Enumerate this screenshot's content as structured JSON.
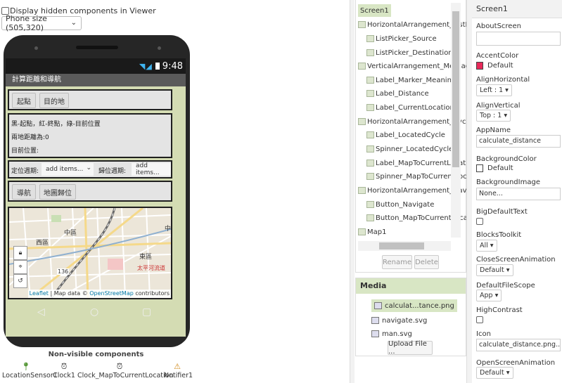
{
  "viewer": {
    "hidden_label": "Display hidden components in Viewer",
    "phone_size": "Phone size (505,320)",
    "time": "9:48",
    "screen_title": "計算距離和導航",
    "buttons_row1": [
      "起點",
      "目的地"
    ],
    "labels": [
      "黑-起點，紅-終點，綠-目前位置",
      "兩地距離為:0",
      "目前位置:"
    ],
    "located_cycle_label": "定位週期:",
    "located_cycle_spinner": "add items...",
    "map_cycle_label": "歸位週期:",
    "map_cycle_spinner": "add items...",
    "buttons_row3": [
      "導航",
      "地圖歸位"
    ],
    "map_labels": [
      "中區",
      "西區",
      "東區",
      "136",
      "太平河流道",
      "中"
    ],
    "attribution": {
      "leaflet": "Leaflet",
      "sep": " | Map data © ",
      "osm": "OpenStreetMap",
      "tail": " contributors"
    },
    "nonvisible_title": "Non-visible components",
    "nonvisible": [
      {
        "name": "LocationSensor1",
        "icon": "location-icon"
      },
      {
        "name": "Clock1",
        "icon": "clock-icon"
      },
      {
        "name": "Clock_MapToCurrentLocation",
        "icon": "clock-icon"
      },
      {
        "name": "Notifier1",
        "icon": "warning-icon"
      }
    ]
  },
  "tree": {
    "items": [
      "Screen1",
      "HorizontalArrangement_ListPi",
      "ListPicker_Source",
      "ListPicker_Destination",
      "VerticalArrangement_Messag",
      "Label_Marker_Meaning",
      "Label_Distance",
      "Label_CurrentLocation",
      "HorizontalArrangement_Cycle",
      "Label_LocatedCycle",
      "Spinner_LocatedCycle",
      "Label_MapToCurrentLocatio",
      "Spinner_MapToCurrentLoca",
      "HorizontalArrangement_Navig",
      "Button_Navigate",
      "Button_MapToCurrentLoca",
      "Map1"
    ],
    "rename": "Rename",
    "delete": "Delete"
  },
  "media": {
    "title": "Media",
    "files": [
      "calculat...tance.png",
      "navigate.svg",
      "man.svg"
    ],
    "upload": "Upload File ..."
  },
  "props": {
    "header": "Screen1",
    "about_screen": "AboutScreen",
    "accent_color": "AccentColor",
    "accent_value": "Default",
    "accent_hex": "#e8295a",
    "align_h": "AlignHorizontal",
    "align_h_value": "Left : 1 ▾",
    "align_v": "AlignVertical",
    "align_v_value": "Top : 1 ▾",
    "app_name": "AppName",
    "app_name_value": "calculate_distance",
    "bg_color": "BackgroundColor",
    "bg_color_value": "Default",
    "bg_image": "BackgroundImage",
    "bg_image_value": "None...",
    "big_text": "BigDefaultText",
    "blocks_toolkit": "BlocksToolkit",
    "blocks_toolkit_value": "All ▾",
    "close_anim": "CloseScreenAnimation",
    "close_anim_value": "Default ▾",
    "file_scope": "DefaultFileScope",
    "file_scope_value": "App ▾",
    "high_contrast": "HighContrast",
    "icon": "Icon",
    "icon_value": "calculate_distance.png...",
    "open_anim": "OpenScreenAnimation",
    "open_anim_value": "Default ▾"
  }
}
